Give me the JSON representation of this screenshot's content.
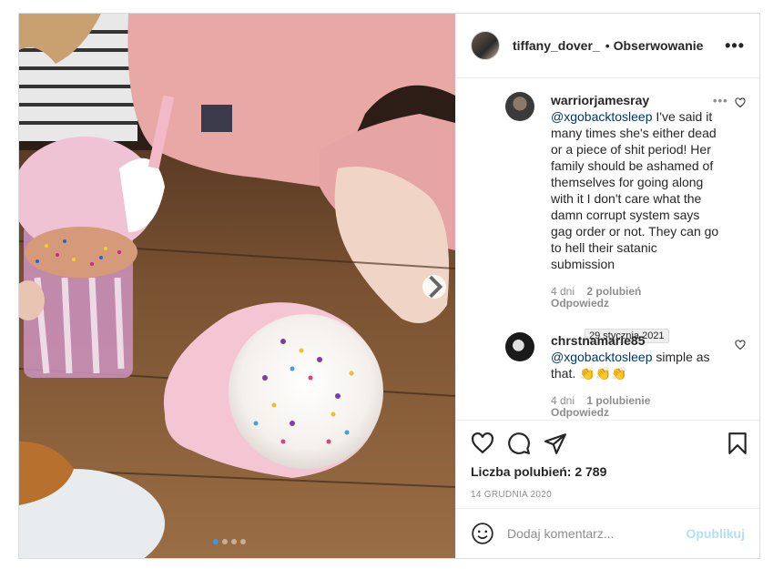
{
  "header": {
    "username": "tiffany_dover_",
    "separator": "•",
    "follow_label": "Obserwowanie",
    "more_label": "•••"
  },
  "comments": [
    {
      "username": "warriorjamesray",
      "mention": "@xgobacktosleep",
      "text": " I've said it many times she's either dead or a piece of shit period! Her family should be ashamed of themselves for going along with it I don't care what the damn corrupt system says gag order or not. They can go to hell their satanic submission",
      "days": "4 dni",
      "likes": "2 polubień",
      "reply_label": "Odpowiedz",
      "more_label": "•••"
    },
    {
      "username": "chrstnamarie85",
      "mention": "@xgobacktosleep",
      "text": " simple as that. 👏👏👏",
      "days": "4 dni",
      "likes": "1 polubienie",
      "reply_label": "Odpowiedz"
    }
  ],
  "tooltip": "29 stycznia 2021",
  "actions": {
    "likes_text": "Liczba polubień: 2 789",
    "date": "14 GRUDNIA 2020"
  },
  "add_comment": {
    "placeholder": "Dodaj komentarz...",
    "publish_label": "Opublikuj"
  },
  "carousel": {
    "slide_count": 4,
    "active_index": 0
  },
  "colors": {
    "link": "#00376b",
    "accent_blue": "#3897f0",
    "publish_disabled": "#b2dffc",
    "muted": "#8e8e8e"
  },
  "icons": [
    "heart-icon",
    "comment-icon",
    "share-icon",
    "bookmark-icon",
    "emoji-icon",
    "more-icon",
    "chevron-right-icon"
  ]
}
